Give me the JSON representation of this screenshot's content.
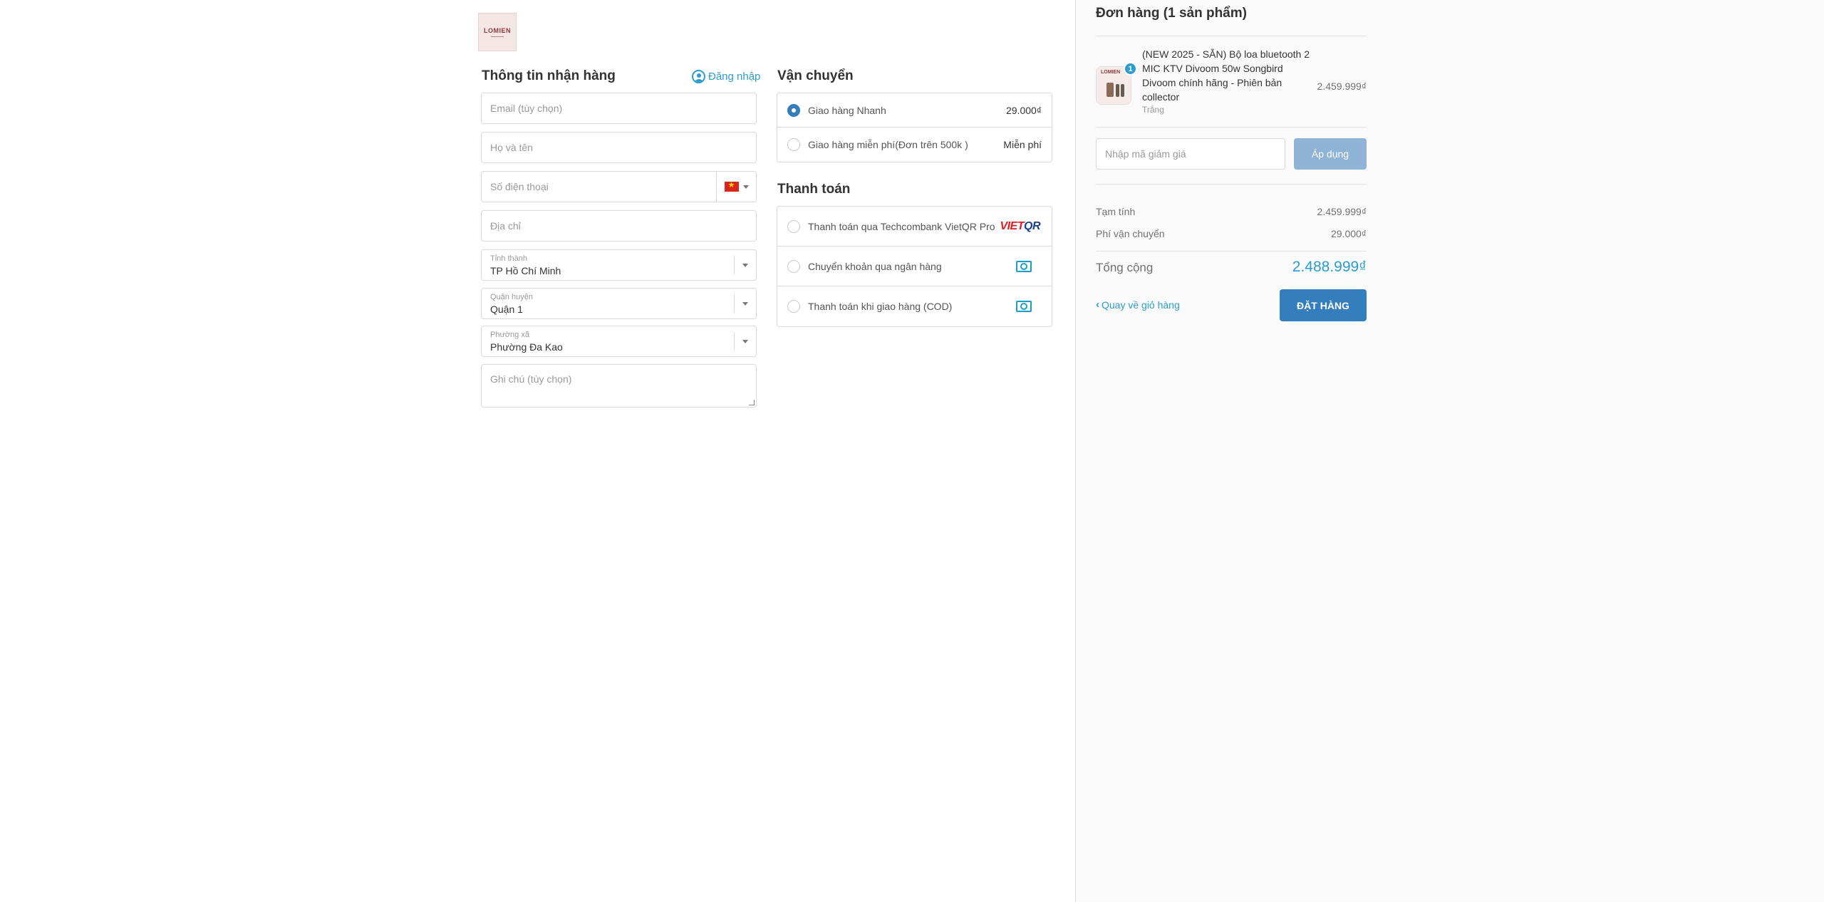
{
  "brand": {
    "logo_text": "LOMIEN"
  },
  "shipping_info": {
    "title": "Thông tin nhận hàng",
    "login_label": "Đăng nhập",
    "email_placeholder": "Email (tùy chọn)",
    "name_placeholder": "Họ và tên",
    "phone_placeholder": "Số điện thoại",
    "address_placeholder": "Địa chỉ",
    "province": {
      "label": "Tỉnh thành",
      "value": "TP Hồ Chí Minh"
    },
    "district": {
      "label": "Quận huyện",
      "value": "Quận 1"
    },
    "ward": {
      "label": "Phường xã",
      "value": "Phường Đa Kao"
    },
    "note_placeholder": "Ghi chú (tùy chọn)"
  },
  "shipping": {
    "title": "Vận chuyển",
    "options": [
      {
        "label": "Giao hàng Nhanh",
        "price": "29.000₫",
        "selected": true
      },
      {
        "label": "Giao hàng miễn phí(Đơn trên 500k )",
        "price": "Miễn phí",
        "selected": false
      }
    ]
  },
  "payment": {
    "title": "Thanh toán",
    "options": [
      {
        "label": "Thanh toán qua Techcombank VietQR Pro",
        "icon": "vietqr-logo"
      },
      {
        "label": "Chuyển khoản qua ngân hàng",
        "icon": "money-icon"
      },
      {
        "label": "Thanh toán khi giao hàng (COD)",
        "icon": "money-icon"
      }
    ],
    "vietqr_v": "VIET",
    "vietqr_q": "QR"
  },
  "order": {
    "title": "Đơn hàng (1 sản phẩm)",
    "item": {
      "name": "(NEW 2025 - SẴN) Bộ loa bluetooth 2 MIC KTV Divoom 50w Songbird Divoom chính hãng - Phiên bản collector",
      "variant": "Trắng",
      "price": "2.459.999₫",
      "quantity": "1"
    },
    "coupon_placeholder": "Nhập mã giảm giá",
    "apply_label": "Áp dụng",
    "subtotal_label": "Tạm tính",
    "subtotal_value": "2.459.999₫",
    "shipping_fee_label": "Phí vận chuyển",
    "shipping_fee_value": "29.000₫",
    "total_label": "Tổng cộng",
    "total_value": "2.488.999₫",
    "back_label": "Quay về giỏ hàng",
    "order_button": "ĐẶT HÀNG"
  },
  "colors": {
    "accent": "#2a9dcc",
    "primary_button": "#357ebd",
    "apply_button": "#8fb3d5"
  }
}
